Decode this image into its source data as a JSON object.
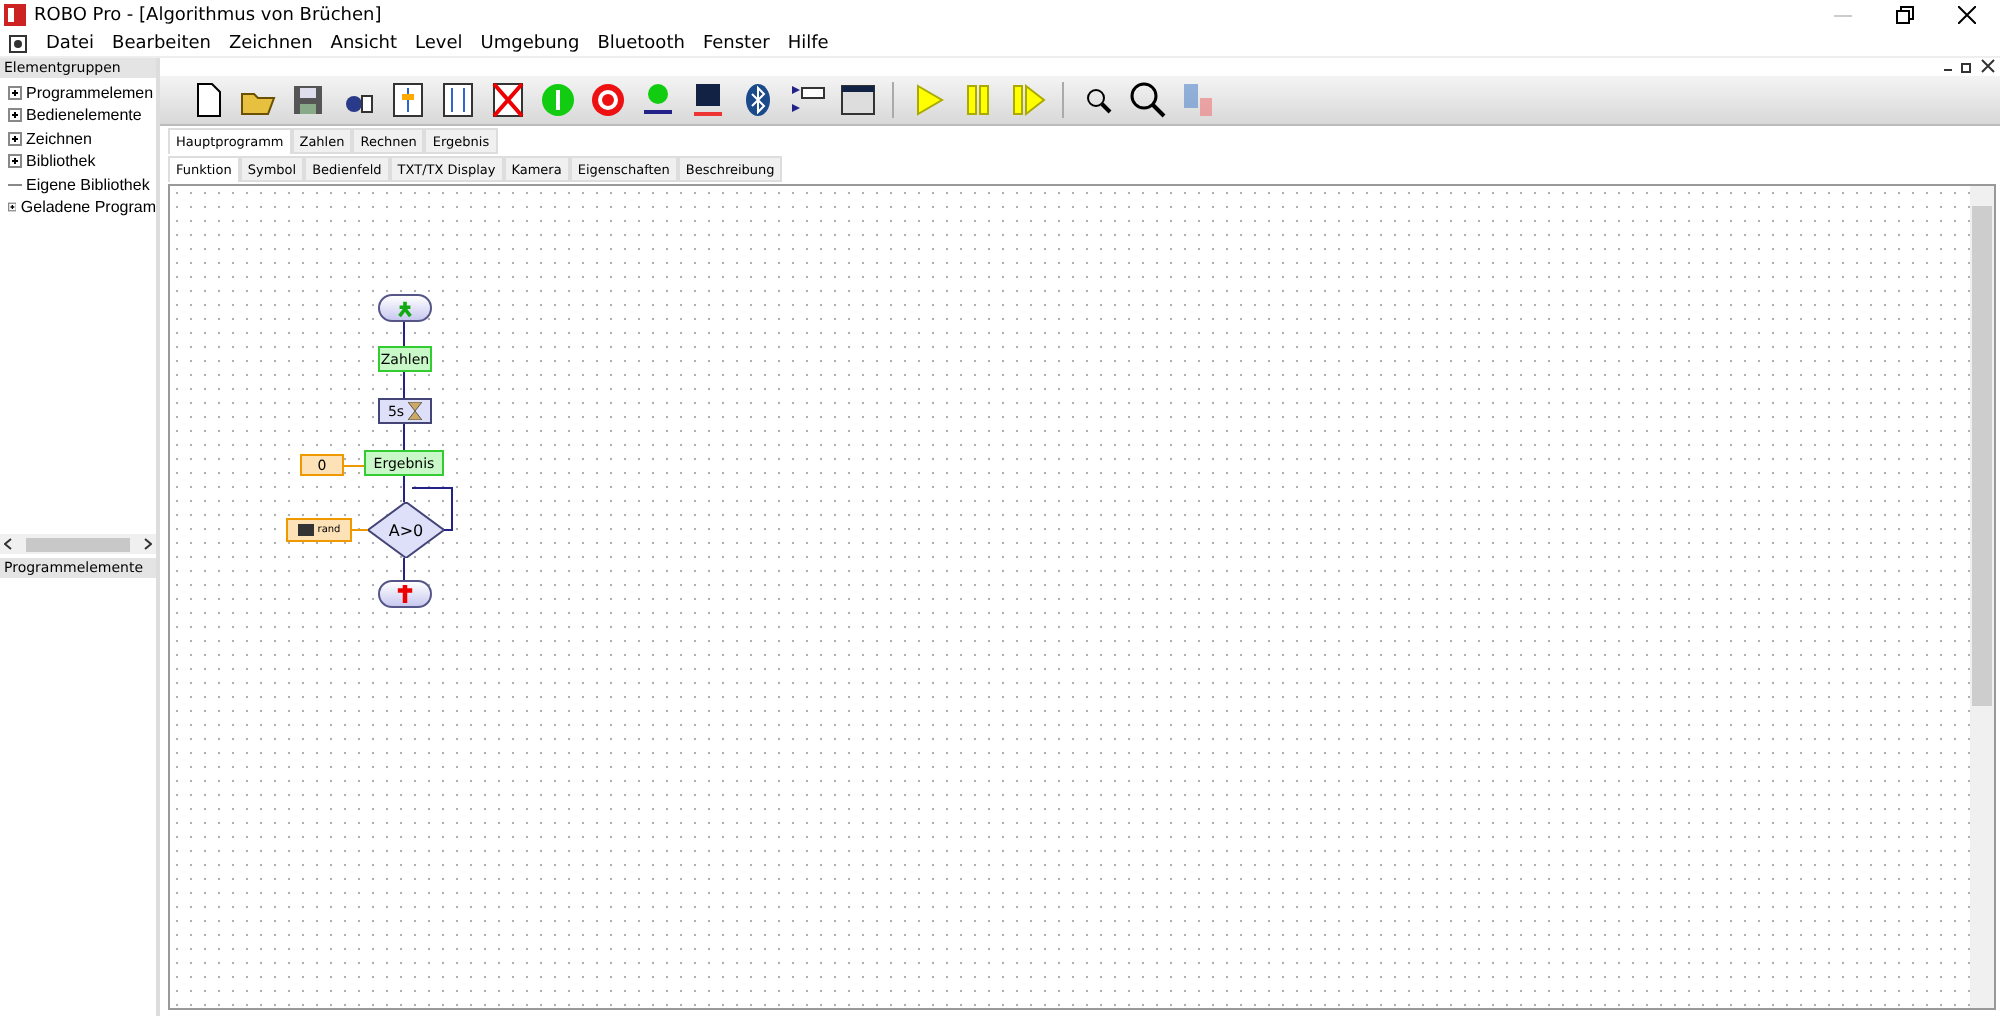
{
  "window": {
    "title": "ROBO Pro - [Algorithmus von Brüchen]"
  },
  "menu": [
    "Datei",
    "Bearbeiten",
    "Zeichnen",
    "Ansicht",
    "Level",
    "Umgebung",
    "Bluetooth",
    "Fenster",
    "Hilfe"
  ],
  "sidebar": {
    "title": "Elementgruppen",
    "items": [
      {
        "label": "Programmelemen",
        "expandable": true
      },
      {
        "label": "Bedienelemente",
        "expandable": true
      },
      {
        "label": "Zeichnen",
        "expandable": true
      },
      {
        "label": "Bibliothek",
        "expandable": true
      },
      {
        "label": "Eigene Bibliothek",
        "expandable": false
      },
      {
        "label": "Geladene Program",
        "expandable": true
      }
    ],
    "bottom_title": "Programmelemente"
  },
  "program_tabs": [
    {
      "label": "Hauptprogramm",
      "selected": true
    },
    {
      "label": "Zahlen",
      "selected": false
    },
    {
      "label": "Rechnen",
      "selected": false
    },
    {
      "label": "Ergebnis",
      "selected": false
    }
  ],
  "view_tabs": [
    {
      "label": "Funktion",
      "selected": true
    },
    {
      "label": "Symbol",
      "selected": false
    },
    {
      "label": "Bedienfeld",
      "selected": false
    },
    {
      "label": "TXT/TX Display",
      "selected": false
    },
    {
      "label": "Kamera",
      "selected": false
    },
    {
      "label": "Eigenschaften",
      "selected": false
    },
    {
      "label": "Beschreibung",
      "selected": false
    }
  ],
  "diagram": {
    "nodes": [
      {
        "kind": "start"
      },
      {
        "kind": "subprogram",
        "label": "Zahlen"
      },
      {
        "kind": "wait",
        "label": "5s"
      },
      {
        "kind": "constant",
        "label": "0"
      },
      {
        "kind": "subprogram",
        "label": "Ergebnis"
      },
      {
        "kind": "variable",
        "label": "rand"
      },
      {
        "kind": "branch",
        "label": "A>0"
      },
      {
        "kind": "end"
      }
    ]
  }
}
